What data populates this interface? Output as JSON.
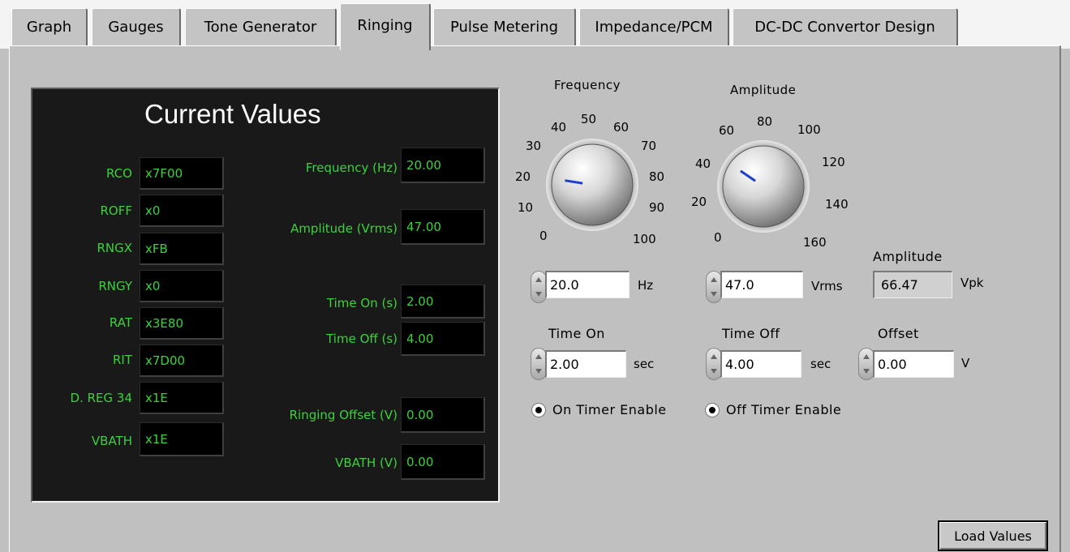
{
  "tabs": [
    {
      "label": "Graph"
    },
    {
      "label": "Gauges"
    },
    {
      "label": "Tone Generator"
    },
    {
      "label": "Ringing"
    },
    {
      "label": "Pulse Metering"
    },
    {
      "label": "Impedance/PCM"
    },
    {
      "label": "DC-DC Convertor Design"
    }
  ],
  "current_values": {
    "title": "Current Values",
    "registers": [
      {
        "label": "RCO",
        "value": "x7F00"
      },
      {
        "label": "ROFF",
        "value": "x0"
      },
      {
        "label": "RNGX",
        "value": "xFB"
      },
      {
        "label": "RNGY",
        "value": "x0"
      },
      {
        "label": "RAT",
        "value": "x3E80"
      },
      {
        "label": "RIT",
        "value": "x7D00"
      },
      {
        "label": "D. REG 34",
        "value": "x1E"
      },
      {
        "label": "VBATH",
        "value": "x1E"
      }
    ],
    "readouts": [
      {
        "label": "Frequency (Hz)",
        "value": "20.00"
      },
      {
        "label": "Amplitude (Vrms)",
        "value": "47.00"
      },
      {
        "label": "Time On (s)",
        "value": "2.00"
      },
      {
        "label": "Time Off (s)",
        "value": "4.00"
      },
      {
        "label": "Ringing Offset (V)",
        "value": "0.00"
      },
      {
        "label": "VBATH (V)",
        "value": "0.00"
      }
    ]
  },
  "frequency_knob": {
    "title": "Frequency",
    "value": 20,
    "min": 0,
    "max": 100,
    "scale": [
      "0",
      "10",
      "20",
      "30",
      "40",
      "50",
      "60",
      "70",
      "80",
      "90",
      "100"
    ]
  },
  "amplitude_knob": {
    "title": "Amplitude",
    "value": 47,
    "min": 0,
    "max": 160,
    "scale": [
      "0",
      "20",
      "40",
      "60",
      "80",
      "100",
      "120",
      "140",
      "160"
    ]
  },
  "controls": {
    "frequency": {
      "value": "20.0",
      "unit": "Hz"
    },
    "amplitude": {
      "value": "47.0",
      "unit": "Vrms"
    },
    "amplitude_vpk": {
      "label": "Amplitude",
      "value": "66.47",
      "unit": "Vpk"
    },
    "time_on": {
      "label": "Time On",
      "value": "2.00",
      "unit": "sec"
    },
    "time_off": {
      "label": "Time Off",
      "value": "4.00",
      "unit": "sec"
    },
    "offset": {
      "label": "Offset",
      "value": "0.00",
      "unit": "V"
    },
    "on_timer_enable": {
      "label": "On Timer Enable",
      "checked": true
    },
    "off_timer_enable": {
      "label": "Off Timer Enable",
      "checked": true
    }
  },
  "load_button": {
    "label": "Load Values"
  },
  "colors": {
    "display_bg": "#191919",
    "display_text": "#3cd23c",
    "needle": "#1f3fcc",
    "panel": "#c0c0c0"
  }
}
